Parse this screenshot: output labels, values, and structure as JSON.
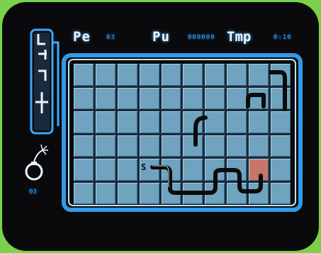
{
  "hud": {
    "pe_label": "Pe",
    "pe_value": "03",
    "pu_label": "Pu",
    "pu_value": "000000",
    "tmp_label": "Tmp",
    "tmp_value": "0:10"
  },
  "bomb_count": "03",
  "start_marker": "S",
  "colors": {
    "background": "#7bd24a",
    "screen": "#0a0a0c",
    "frame_glow": "#3aa8ff",
    "tile": "#6fa3c0",
    "pipe": "#0b0b0b",
    "marked_tile": "#c8746a"
  },
  "grid": {
    "columns": 10,
    "rows": 6
  }
}
